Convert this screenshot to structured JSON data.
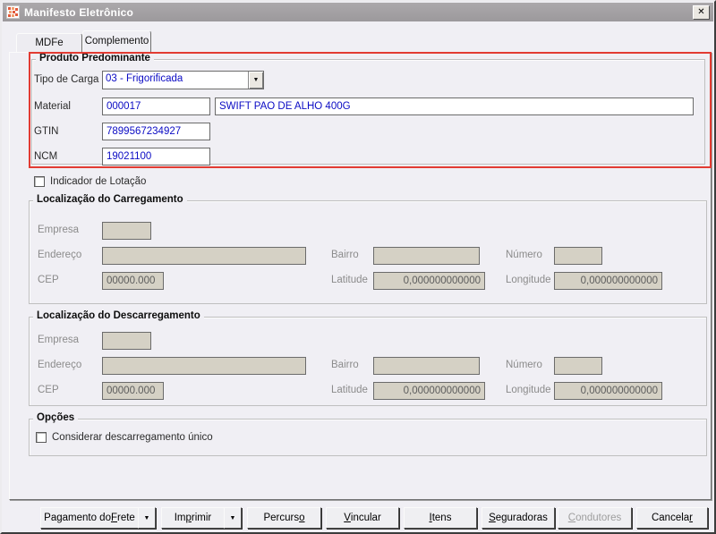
{
  "window": {
    "title": "Manifesto Eletrônico"
  },
  "icons": {
    "close": "✕",
    "dropdown": "▼"
  },
  "tabs": {
    "mdfe": "MDFe",
    "complemento": "Complemento"
  },
  "produto": {
    "group_title": "Produto Predominante",
    "tipo_carga_label": "Tipo de Carga",
    "tipo_carga_value": "03 - Frigorificada",
    "material_label": "Material",
    "material_code": "000017",
    "material_desc": "SWIFT PAO DE ALHO 400G",
    "gtin_label": "GTIN",
    "gtin_value": "7899567234927",
    "ncm_label": "NCM",
    "ncm_value": "19021100"
  },
  "lotacao": {
    "label": "Indicador de Lotação",
    "checked": false
  },
  "carregamento": {
    "group_title": "Localização do Carregamento",
    "empresa_label": "Empresa",
    "endereco_label": "Endereço",
    "bairro_label": "Bairro",
    "numero_label": "Número",
    "cep_label": "CEP",
    "cep_value": "00000.000",
    "latitude_label": "Latitude",
    "latitude_value": "0,000000000000",
    "longitude_label": "Longitude",
    "longitude_value": "0,000000000000"
  },
  "descarregamento": {
    "group_title": "Localização do Descarregamento",
    "empresa_label": "Empresa",
    "endereco_label": "Endereço",
    "bairro_label": "Bairro",
    "numero_label": "Número",
    "cep_label": "CEP",
    "cep_value": "00000.000",
    "latitude_label": "Latitude",
    "latitude_value": "0,000000000000",
    "longitude_label": "Longitude",
    "longitude_value": "0,000000000000"
  },
  "opcoes": {
    "group_title": "Opções",
    "checkbox_label": "Considerar descarregamento único",
    "checked": false
  },
  "buttons": [
    {
      "pre": "Pagamento do ",
      "key": "F",
      "post": "rete",
      "split": true
    },
    {
      "pre": "Im",
      "key": "p",
      "post": "rimir",
      "split": true
    },
    {
      "pre": "Percurs",
      "key": "o",
      "post": ""
    },
    {
      "pre": "",
      "key": "V",
      "post": "incular"
    },
    {
      "pre": "",
      "key": "I",
      "post": "tens"
    },
    {
      "pre": "",
      "key": "S",
      "post": "eguradoras"
    },
    {
      "pre": "",
      "key": "C",
      "post": "ondutores",
      "disabled": true
    },
    {
      "pre": "Cancela",
      "key": "r",
      "post": ""
    }
  ]
}
